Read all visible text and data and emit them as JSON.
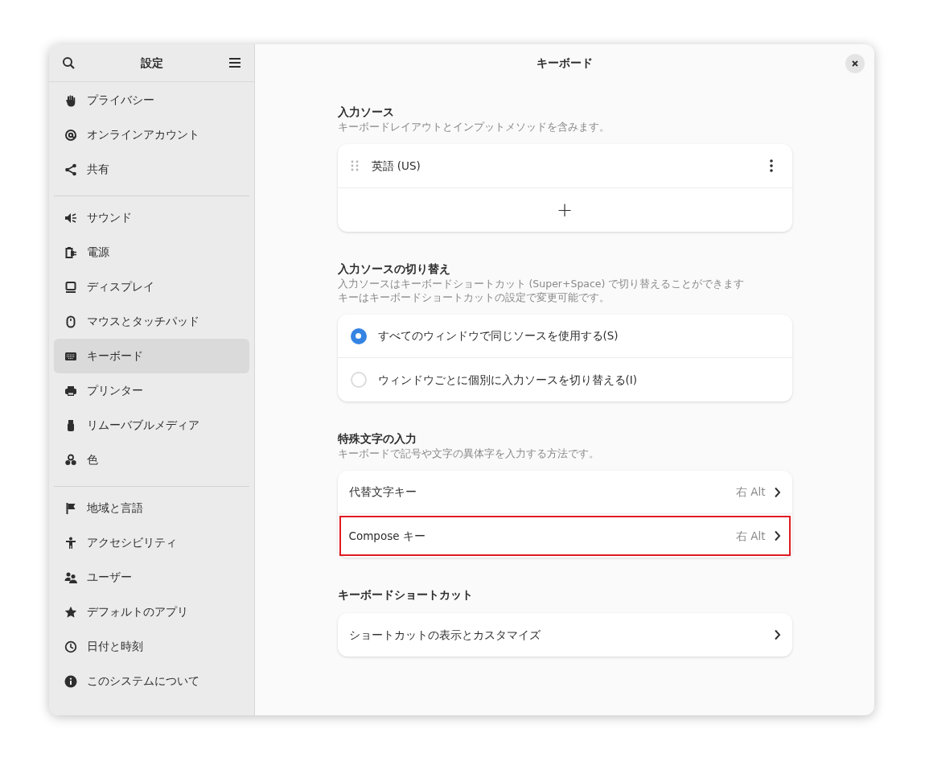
{
  "sidebar": {
    "title": "設定",
    "groups": [
      {
        "items": [
          {
            "label": "プライバシー",
            "selected": false
          },
          {
            "label": "オンラインアカウント",
            "selected": false
          },
          {
            "label": "共有",
            "selected": false
          }
        ]
      },
      {
        "items": [
          {
            "label": "サウンド",
            "selected": false
          },
          {
            "label": "電源",
            "selected": false
          },
          {
            "label": "ディスプレイ",
            "selected": false
          },
          {
            "label": "マウスとタッチパッド",
            "selected": false
          },
          {
            "label": "キーボード",
            "selected": true
          },
          {
            "label": "プリンター",
            "selected": false
          },
          {
            "label": "リムーバブルメディア",
            "selected": false
          },
          {
            "label": "色",
            "selected": false
          }
        ]
      },
      {
        "items": [
          {
            "label": "地域と言語",
            "selected": false
          },
          {
            "label": "アクセシビリティ",
            "selected": false
          },
          {
            "label": "ユーザー",
            "selected": false
          },
          {
            "label": "デフォルトのアプリ",
            "selected": false
          },
          {
            "label": "日付と時刻",
            "selected": false
          },
          {
            "label": "このシステムについて",
            "selected": false
          }
        ]
      }
    ]
  },
  "page": {
    "title": "キーボード",
    "sections": [
      {
        "kind": "sources",
        "title": "入力ソース",
        "description": [
          "キーボードレイアウトとインプットメソッドを含みます。"
        ],
        "rows": [
          {
            "label": "英語 (US)"
          }
        ],
        "add_button": "+"
      },
      {
        "kind": "radio",
        "title": "入力ソースの切り替え",
        "description": [
          "入力ソースはキーボードショートカット (Super+Space) で切り替えることができます",
          "キーはキーボードショートカットの設定で変更可能です。"
        ],
        "rows": [
          {
            "label": "すべてのウィンドウで同じソースを使用する(S)",
            "selected": true
          },
          {
            "label": "ウィンドウごとに個別に入力ソースを切り替える(I)",
            "selected": false
          }
        ]
      },
      {
        "kind": "nav",
        "title": "特殊文字の入力",
        "description": [
          "キーボードで記号や文字の異体字を入力する方法です。"
        ],
        "rows": [
          {
            "label": "代替文字キー",
            "value": "右 Alt",
            "highlighted": false
          },
          {
            "label": "Compose キー",
            "value": "右 Alt",
            "highlighted": true
          }
        ]
      },
      {
        "kind": "nav",
        "title": "キーボードショートカット",
        "rows": [
          {
            "label": "ショートカットの表示とカスタマイズ",
            "highlighted": false
          }
        ]
      }
    ]
  }
}
